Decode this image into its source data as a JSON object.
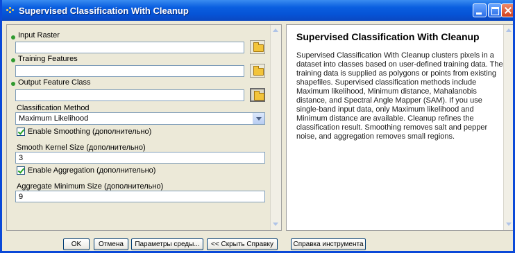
{
  "window": {
    "title": "Supervised Classification With Cleanup"
  },
  "form": {
    "input_raster": {
      "label": "Input Raster",
      "value": ""
    },
    "training_features": {
      "label": "Training Features",
      "value": ""
    },
    "output_feature_class": {
      "label": "Output Feature Class",
      "value": ""
    },
    "classification_method": {
      "label": "Classification Method",
      "value": "Maximum Likelihood"
    },
    "enable_smoothing": {
      "label": "Enable Smoothing (дополнительно)",
      "checked": true
    },
    "smooth_kernel_size": {
      "label": "Smooth Kernel Size (дополнительно)",
      "value": "3"
    },
    "enable_aggregation": {
      "label": "Enable Aggregation (дополнительно)",
      "checked": true
    },
    "aggregate_minimum_size": {
      "label": "Aggregate Minimum Size (дополнительно)",
      "value": "9"
    }
  },
  "help": {
    "title": "Supervised Classification With Cleanup",
    "body": "Supervised Classification With Cleanup clusters pixels in a dataset into classes based on user-defined training data. The training data is supplied as polygons or points from existing shapefiles. Supervised classification methods include Maximum likelihood, Minimum distance, Mahalanobis distance, and Spectral Angle Mapper (SAM). If you use single-band input data, only Maximum likelihood and Minimum distance are available. Cleanup refines the classification result. Smoothing removes salt and pepper noise, and aggregation removes small regions."
  },
  "buttons": {
    "ok": "OK",
    "cancel": "Отмена",
    "environments": "Параметры среды...",
    "hide_help": "<< Скрыть Справку",
    "tool_help": "Справка инструмента"
  },
  "colors": {
    "title_bar": "#0653d6",
    "required_dot": "#2f9a2f",
    "checkbox_mark": "#21a121"
  }
}
